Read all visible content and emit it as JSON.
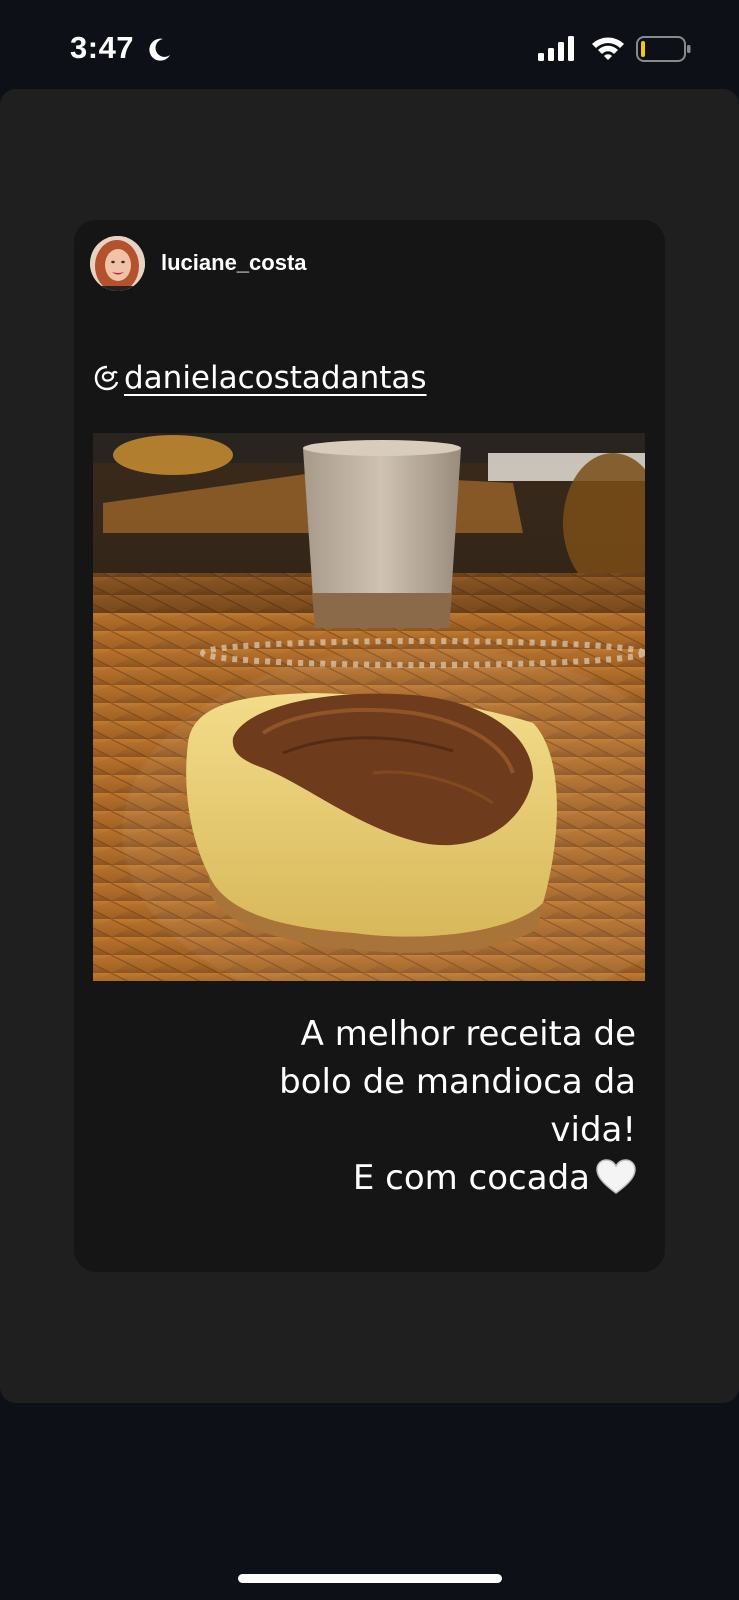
{
  "status_bar": {
    "time": "3:47",
    "icons": [
      "moon-icon",
      "cellular-signal-icon",
      "wifi-icon",
      "battery-icon"
    ],
    "battery_level": 0.1,
    "battery_color": "#f5c518"
  },
  "post": {
    "username": "luciane_costa",
    "mention": "danielacostadantas",
    "caption": {
      "line1": "A melhor receita de",
      "line2": "bolo de mandioca da",
      "line3": "vida!",
      "line4": "E com cocada"
    },
    "caption_emoji": "white-heart-icon"
  },
  "colors": {
    "background": "#0d1117",
    "story_area": "#1f1f1f",
    "card": "#151515",
    "text": "#ffffff"
  }
}
